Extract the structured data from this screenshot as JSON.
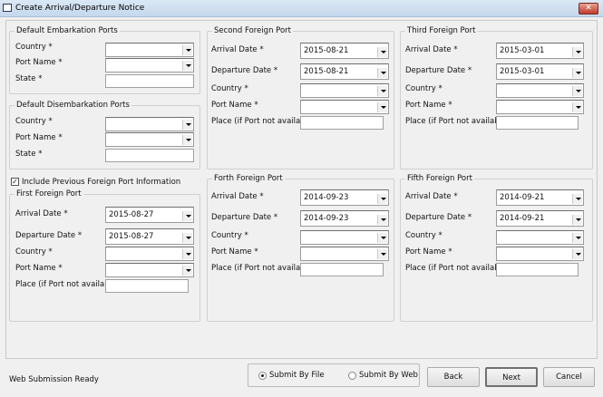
{
  "window": {
    "title": "Create Arrival/Departure Notice",
    "close": "✕"
  },
  "embarkation": {
    "title": "Default Embarkation Ports",
    "country": "Country *",
    "port": "Port Name *",
    "state": "State *"
  },
  "disembarkation": {
    "title": "Default Disembarkation Ports",
    "country": "Country *",
    "port": "Port Name *",
    "state": "State *"
  },
  "include_previous": {
    "label": "Include Previous Foreign Port Information",
    "checked": true,
    "mark": "✓"
  },
  "labels": {
    "arrival": "Arrival Date *",
    "departure": "Departure Date *",
    "country": "Country *",
    "port": "Port Name *",
    "place": "Place (if Port not available)"
  },
  "ports": [
    {
      "title": "First Foreign Port",
      "arrival": "2015-08-27",
      "departure": "2015-08-27"
    },
    {
      "title": "Second Foreign Port",
      "arrival": "2015-08-21",
      "departure": "2015-08-21"
    },
    {
      "title": "Third Foreign Port",
      "arrival": "2015-03-01",
      "departure": "2015-03-01"
    },
    {
      "title": "Forth Foreign Port",
      "arrival": "2014-09-23",
      "departure": "2014-09-23"
    },
    {
      "title": "Fifth Foreign Port",
      "arrival": "2014-09-21",
      "departure": "2014-09-21"
    }
  ],
  "status": "Web Submission Ready",
  "submit": {
    "by_file": "Submit By File",
    "by_web": "Submit By Web",
    "selected": "by_file"
  },
  "buttons": {
    "back": "Back",
    "next": "Next",
    "cancel": "Cancel"
  }
}
